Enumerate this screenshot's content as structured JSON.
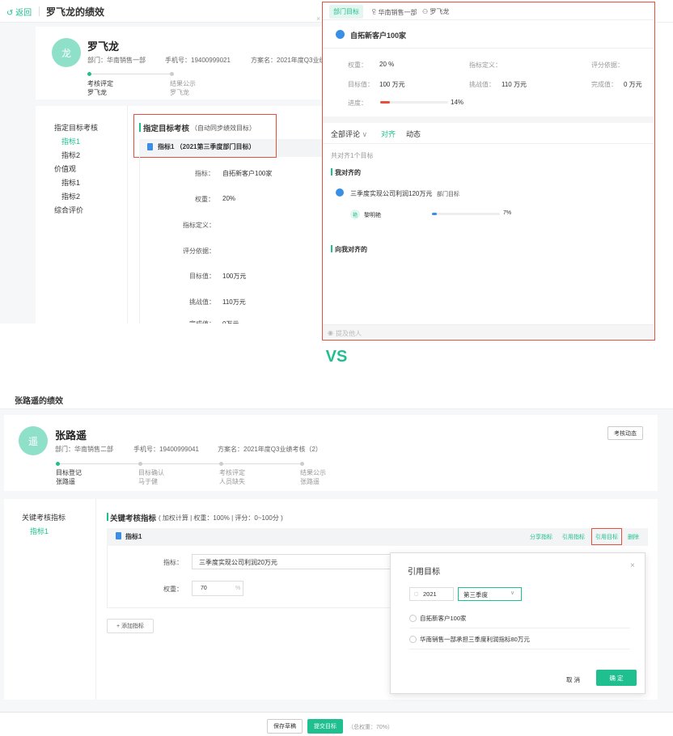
{
  "top": {
    "back_label": "返回",
    "page_title": "罗飞龙的绩效",
    "person": {
      "avatar_char": "龙",
      "name": "罗飞龙",
      "dept": "部门：华南销售一部",
      "phone": "手机号：19400999021",
      "plan": "方案名：2021年度Q3业绩考"
    },
    "steps": [
      {
        "label": "考核评定",
        "who": "罗飞龙"
      },
      {
        "label": "结果公示",
        "who": "罗飞龙"
      }
    ],
    "left_nav": {
      "group1": "指定目标考核",
      "group1_items": [
        "指标1",
        "指标2"
      ],
      "group2": "价值观",
      "group2_items": [
        "指标1",
        "指标2"
      ],
      "group3": "综合评价"
    },
    "section": {
      "title": "指定目标考核",
      "subtitle": "（自动同步绩效目标）",
      "indicator": "指标1 （2021第三季度部门目标）"
    },
    "fields": [
      {
        "label": "指标：",
        "value": "自拓新客户100家"
      },
      {
        "label": "权重：",
        "value": "20%"
      },
      {
        "label": "指标定义：",
        "value": ""
      },
      {
        "label": "评分依据：",
        "value": ""
      },
      {
        "label": "目标值：",
        "value": "100万元"
      },
      {
        "label": "挑战值：",
        "value": "110万元"
      },
      {
        "label": "完成值：",
        "value": "0万元"
      }
    ],
    "panel": {
      "tabs": [
        "部门目标",
        "华南销售一部",
        "罗飞龙"
      ],
      "goal_title": "自拓新客户100家",
      "weight_label": "权重：",
      "weight_value": "20 %",
      "def_label": "指标定义：",
      "basis_label": "评分依据：",
      "target_label": "目标值：",
      "target_value": "100 万元",
      "challenge_label": "挑战值：",
      "challenge_value": "110 万元",
      "done_label": "完成值：",
      "done_value": "0 万元",
      "progress_label": "进度：",
      "progress_value": "14%",
      "progress": 0.14,
      "sub_tabs": [
        "全部评论",
        "对齐",
        "动态"
      ],
      "aligned_count": "共对齐1个目标",
      "my_aligned": "我对齐的",
      "aligned_goal": "三季度实现公司利润120万元",
      "aligned_tag": "部门目标",
      "assignee_char": "艳",
      "assignee": "黎明艳",
      "assignee_progress_value": "7%",
      "assignee_progress": 0.07,
      "to_me": "向我对齐的",
      "mention_placeholder": "提及他人"
    }
  },
  "vs_label": "VS",
  "bottom": {
    "page_title": "张路遥的绩效",
    "person": {
      "avatar_char": "遥",
      "name": "张路遥",
      "dept": "部门：华南销售二部",
      "phone": "手机号：19400999041",
      "plan": "方案名：2021年度Q3业绩考核（2）",
      "dynamic_btn": "考核动态"
    },
    "steps": [
      {
        "label": "目标登记",
        "who": "张路遥"
      },
      {
        "label": "目标确认",
        "who": "马于健"
      },
      {
        "label": "考核评定",
        "who": "人员缺失"
      },
      {
        "label": "结果公示",
        "who": "张路遥"
      }
    ],
    "left_nav": {
      "group1": "关键考核指标",
      "item1": "指标1"
    },
    "section": {
      "title": "关键考核指标",
      "subtitle": "( 加权计算 | 权重：100% | 评分：0~100分 )",
      "indicator": "指标1",
      "actions": [
        "分享指标",
        "引用指标",
        "引用目标",
        "删除"
      ]
    },
    "fields": [
      {
        "label": "指标：",
        "value": "三季度实现公司利润20万元"
      },
      {
        "label": "权重：",
        "value": "70",
        "unit": "%"
      }
    ],
    "add_btn": "+ 添加指标",
    "dialog": {
      "title": "引用目标",
      "year": "2021",
      "quarter": "第三季度",
      "options": [
        "自拓新客户100家",
        "华南销售一部承担三季度利润指标80万元"
      ],
      "cancel": "取 消",
      "confirm": "确 定"
    },
    "footer": {
      "save": "保存草稿",
      "submit": "提交目标",
      "total": "（总权重：70%）"
    }
  }
}
